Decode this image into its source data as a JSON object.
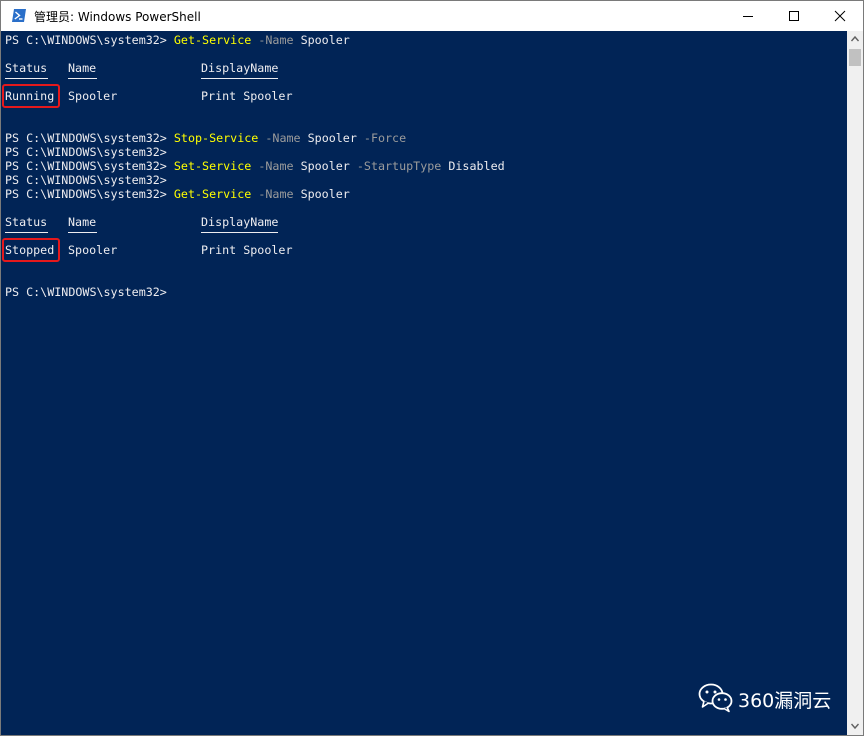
{
  "window": {
    "title": "管理员: Windows PowerShell",
    "console_bg": "#012456",
    "highlight_color": "#e5191c"
  },
  "console": {
    "lines": [
      {
        "prompt": "PS C:\\WINDOWS\\system32> ",
        "cmd": "Get-Service",
        "param1": " -Name",
        "arg1": " Spooler",
        "param2": "",
        "arg2": ""
      },
      {
        "status": "Status",
        "name": "Name",
        "display": "DisplayName"
      },
      {
        "status": "Running",
        "name": "Spooler",
        "display": "Print Spooler"
      },
      {
        "prompt": "PS C:\\WINDOWS\\system32> ",
        "cmd": "Stop-Service",
        "param1": " -Name",
        "arg1": " Spooler",
        "param2": " -Force",
        "arg2": ""
      },
      {
        "prompt": "PS C:\\WINDOWS\\system32>"
      },
      {
        "prompt": "PS C:\\WINDOWS\\system32> ",
        "cmd": "Set-Service",
        "param1": " -Name",
        "arg1": " Spooler",
        "param2": " -StartupType",
        "arg2": " Disabled"
      },
      {
        "prompt": "PS C:\\WINDOWS\\system32>"
      },
      {
        "prompt": "PS C:\\WINDOWS\\system32> ",
        "cmd": "Get-Service",
        "param1": " -Name",
        "arg1": " Spooler",
        "param2": "",
        "arg2": ""
      },
      {
        "status": "Status",
        "name": "Name",
        "display": "DisplayName"
      },
      {
        "status": "Stopped",
        "name": "Spooler",
        "display": "Print Spooler"
      },
      {
        "prompt": "PS C:\\WINDOWS\\system32>"
      }
    ]
  },
  "watermark": {
    "text": "360漏洞云",
    "icon": "wechat-icon"
  }
}
